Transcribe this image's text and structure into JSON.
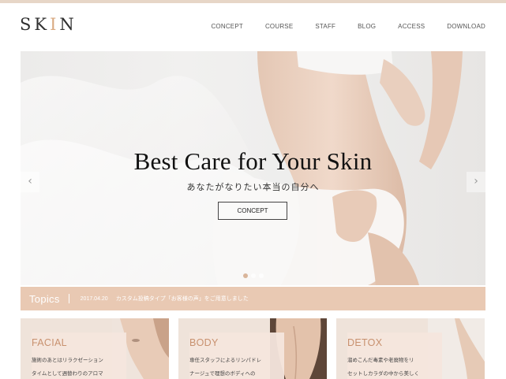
{
  "header": {
    "logo_main_1": "SK",
    "logo_accent": "I",
    "logo_main_2": "N",
    "nav": [
      "CONCEPT",
      "COURSE",
      "STAFF",
      "BLOG",
      "ACCESS",
      "DOWNLOAD"
    ]
  },
  "hero": {
    "title": "Best Care for Your Skin",
    "subtitle": "あなたがなりたい本当の自分へ",
    "button": "CONCEPT",
    "prev_arrow": "‹",
    "next_arrow": "›",
    "slides_total": 3,
    "slide_active": 1
  },
  "topics": {
    "label": "Topics",
    "date": "2017.04.20",
    "text": "カスタム投稿タイプ「お客様の声」をご用意しました"
  },
  "cards": [
    {
      "title": "FACIAL",
      "line1": "施術のあとはリラクゼーション",
      "line2": "タイムとして週替わりのアロマ"
    },
    {
      "title": "BODY",
      "line1": "専任スタッフによるリンパドレ",
      "line2": "ナージュで理想のボディへの"
    },
    {
      "title": "DETOX",
      "line1": "溜めこんだ毒素や老廃物をリ",
      "line2": "セットしカラダの中から美しく"
    }
  ],
  "colors": {
    "accent": "#d9a980",
    "topics_bar": "#e9c9b3",
    "card_title": "#c8916f",
    "top_strip": "#e7d6c7"
  }
}
